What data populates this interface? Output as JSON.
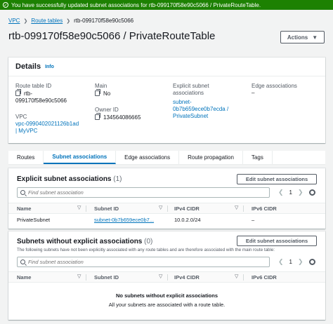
{
  "banner": {
    "text": "You have successfully updated subnet associations for rtb-099170f58e90c5066 / PrivateRouteTable."
  },
  "breadcrumb": {
    "vpc": "VPC",
    "route_tables": "Route tables",
    "current": "rtb-099170f58e90c5066"
  },
  "page": {
    "title": "rtb-099170f58e90c5066 / PrivateRouteTable",
    "actions_label": "Actions"
  },
  "details": {
    "title": "Details",
    "info": "Info",
    "route_table_id_label": "Route table ID",
    "route_table_id_line1": "rtb-",
    "route_table_id_line2": "099170f58e90c5066",
    "main_label": "Main",
    "main_value": "No",
    "explicit_label_line1": "Explicit subnet",
    "explicit_label_line2": "associations",
    "explicit_value_line1": "subnet-",
    "explicit_value_line2": "0b7b659ece0b7ecda /",
    "explicit_value_line3": "PrivateSubnet",
    "edge_label": "Edge associations",
    "edge_value": "–",
    "vpc_label": "VPC",
    "vpc_value_line1": "vpc-0990402021126b1ad",
    "vpc_value_line2": "| MyVPC",
    "owner_label": "Owner ID",
    "owner_value": "134564086665"
  },
  "tabs": [
    "Routes",
    "Subnet associations",
    "Edge associations",
    "Route propagation",
    "Tags"
  ],
  "explicit_section": {
    "title": "Explicit subnet associations",
    "count": "(1)",
    "edit_label": "Edit subnet associations",
    "search_placeholder": "Find subnet association",
    "page": "1",
    "columns": [
      "Name",
      "Subnet ID",
      "IPv4 CIDR",
      "IPv6 CIDR"
    ],
    "rows": [
      {
        "name": "PrivateSubnet",
        "subnet_id": "subnet-0b7b659ece0b7...",
        "ipv4": "10.0.2.0/24",
        "ipv6": "–"
      }
    ]
  },
  "without_section": {
    "title": "Subnets without explicit associations",
    "count": "(0)",
    "edit_label": "Edit subnet associations",
    "note": "The following subnets have not been explicitly associated with any route tables and are therefore associated with the main route table:",
    "search_placeholder": "Find subnet association",
    "page": "1",
    "columns": [
      "Name",
      "Subnet ID",
      "IPv4 CIDR",
      "IPv6 CIDR"
    ],
    "empty_title": "No subnets without explicit associations",
    "empty_sub": "All your subnets are associated with a route table."
  },
  "colors": {
    "success": "#1d8102",
    "link": "#0073bb",
    "border": "#545b64"
  }
}
